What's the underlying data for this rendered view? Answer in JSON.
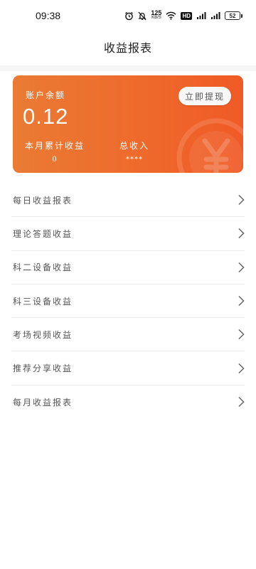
{
  "status_bar": {
    "time": "09:38",
    "net_speed_value": "125",
    "net_speed_unit": "KB/S",
    "hd_badge": "HD",
    "battery_level": "52",
    "icons": [
      "alarm-icon",
      "mute-icon",
      "net-speed",
      "wifi-icon",
      "hd-badge",
      "signal-icon",
      "signal-icon",
      "battery-icon"
    ]
  },
  "header": {
    "title": "收益报表"
  },
  "balance_card": {
    "account_label": "账户余额",
    "amount": "0.12",
    "withdraw_button": "立即提现",
    "month_label": "本月累计收益",
    "month_value": "0",
    "total_label": "总收入",
    "total_value": "****",
    "watermark_icon": "yuan-coin-icon",
    "gradient_colors": [
      "#ea7b34",
      "#f05a26"
    ]
  },
  "menu": {
    "items": [
      {
        "label": "每日收益报表"
      },
      {
        "label": "理论答题收益"
      },
      {
        "label": "科二设备收益"
      },
      {
        "label": "科三设备收益"
      },
      {
        "label": "考场视频收益"
      },
      {
        "label": "推荐分享收益"
      },
      {
        "label": "每月收益报表"
      }
    ],
    "arrow_icon": "chevron-right-icon"
  }
}
